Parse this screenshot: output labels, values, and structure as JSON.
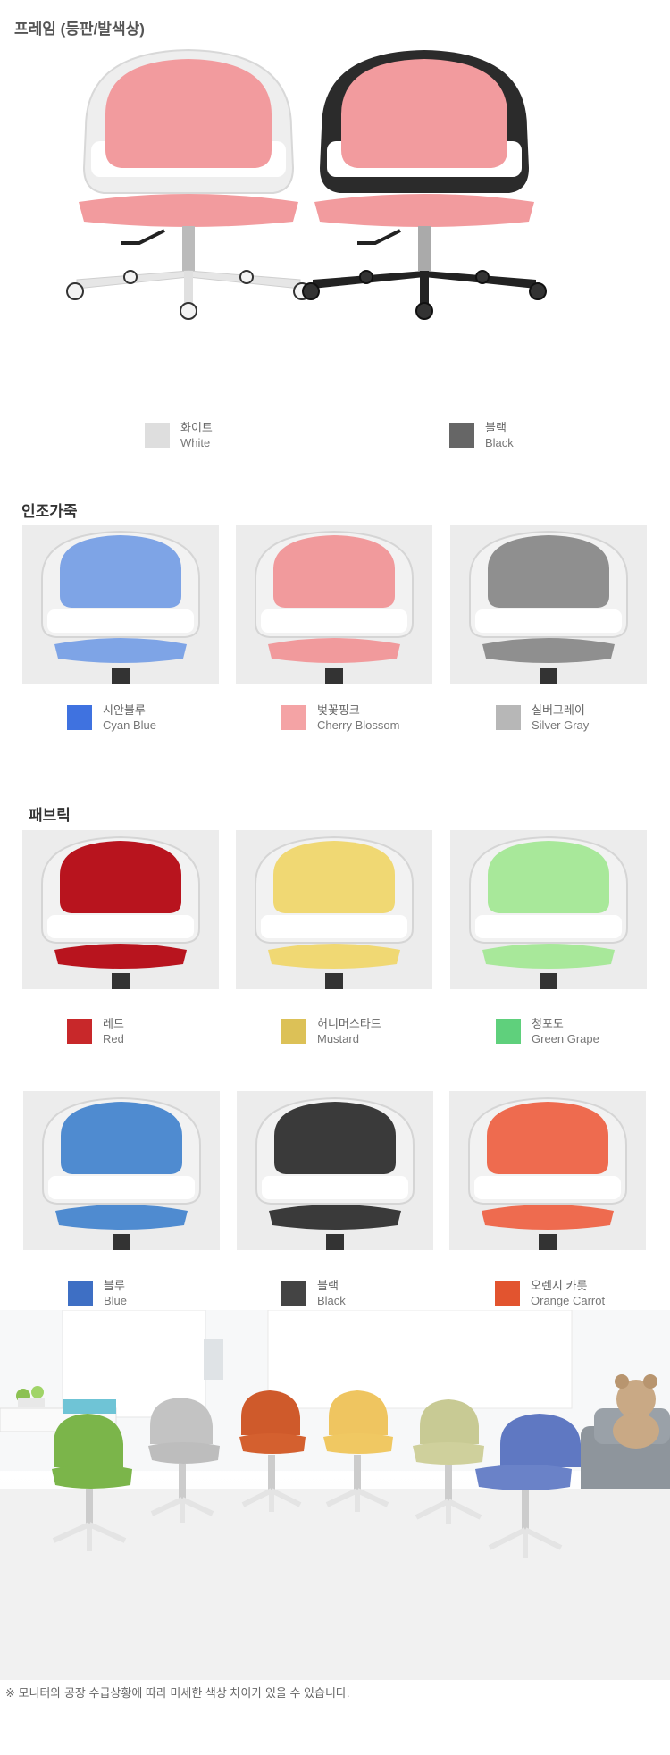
{
  "frame": {
    "title": "프레임 (등판/발색상)",
    "options": [
      {
        "ko": "화이트",
        "en": "White",
        "color": "#dedede"
      },
      {
        "ko": "블랙",
        "en": "Black",
        "color": "#666666"
      }
    ]
  },
  "leather": {
    "title": "인조가죽",
    "options": [
      {
        "ko": "시안블루",
        "en": "Cyan Blue",
        "color": "#3f72e0",
        "seat": "#7ea4e6"
      },
      {
        "ko": "벚꽃핑크",
        "en": "Cherry Blossom",
        "color": "#f4a3a5",
        "seat": "#f19a9c"
      },
      {
        "ko": "실버그레이",
        "en": "Silver Gray",
        "color": "#b7b7b7",
        "seat": "#8f8f8f"
      }
    ]
  },
  "fabric": {
    "title": "패브릭",
    "options": [
      {
        "ko": "레드",
        "en": "Red",
        "color": "#c8282a",
        "seat": "#b8141e"
      },
      {
        "ko": "허니머스타드",
        "en": "Mustard",
        "color": "#dcc157",
        "seat": "#f0d873"
      },
      {
        "ko": "청포도",
        "en": "Green Grape",
        "color": "#5fd07c",
        "seat": "#a8e89a"
      },
      {
        "ko": "블루",
        "en": "Blue",
        "color": "#3e6fc4",
        "seat": "#4f8bd0"
      },
      {
        "ko": "블랙",
        "en": "Black",
        "color": "#444444",
        "seat": "#3a3a3a"
      },
      {
        "ko": "오렌지 카롯",
        "en": "Orange Carrot",
        "color": "#e2542f",
        "seat": "#ee6b4f"
      }
    ]
  },
  "footnote": "※ 모니터와 공장 수급상황에 따라 미세한 색상 차이가 있을 수 있습니다."
}
